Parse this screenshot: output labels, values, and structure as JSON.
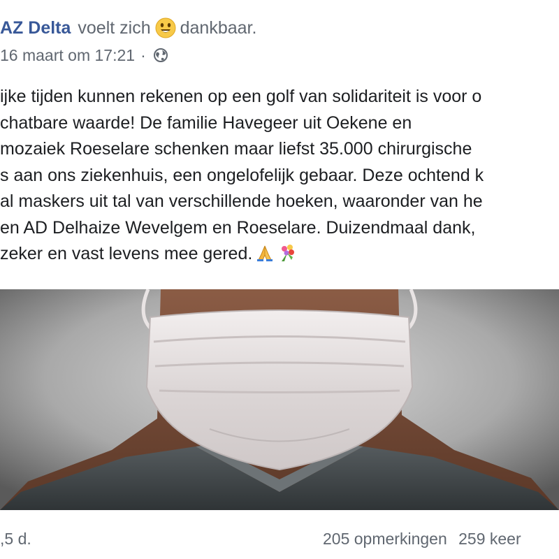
{
  "header": {
    "page_name": "AZ Delta",
    "feeling_prefix": "voelt zich",
    "feeling": "dankbaar.",
    "feeling_icon": "astonished-smile-emoji-icon"
  },
  "meta": {
    "date": "16 maart om 17:21",
    "separator": "·",
    "audience_icon": "globe-icon"
  },
  "post": {
    "lines": [
      "ijke tijden kunnen rekenen op een golf van solidariteit is voor o",
      "chatbare waarde! De familie Havegeer uit Oekene en",
      "mozaiek Roeselare schenken maar liefst 35.000 chirurgische",
      "s aan ons ziekenhuis, een ongelofelijk gebaar. Deze ochtend k",
      "al maskers uit tal van verschillende hoeken, waaronder van he",
      " en AD Delhaize Wevelgem en Roeselare. Duizendmaal dank,",
      " zeker en vast levens mee gered."
    ],
    "end_icons": [
      "folded-hands-emoji-icon",
      "bouquet-emoji-icon"
    ]
  },
  "image": {
    "subject_icon": "surgical-mask-photo"
  },
  "footer": {
    "reactions_count": ",5 d.",
    "comments": "205 opmerkingen",
    "shares": "259 keer"
  },
  "colors": {
    "link_blue": "#385898",
    "secondary_text": "#606770",
    "primary_text": "#1c1e21"
  }
}
